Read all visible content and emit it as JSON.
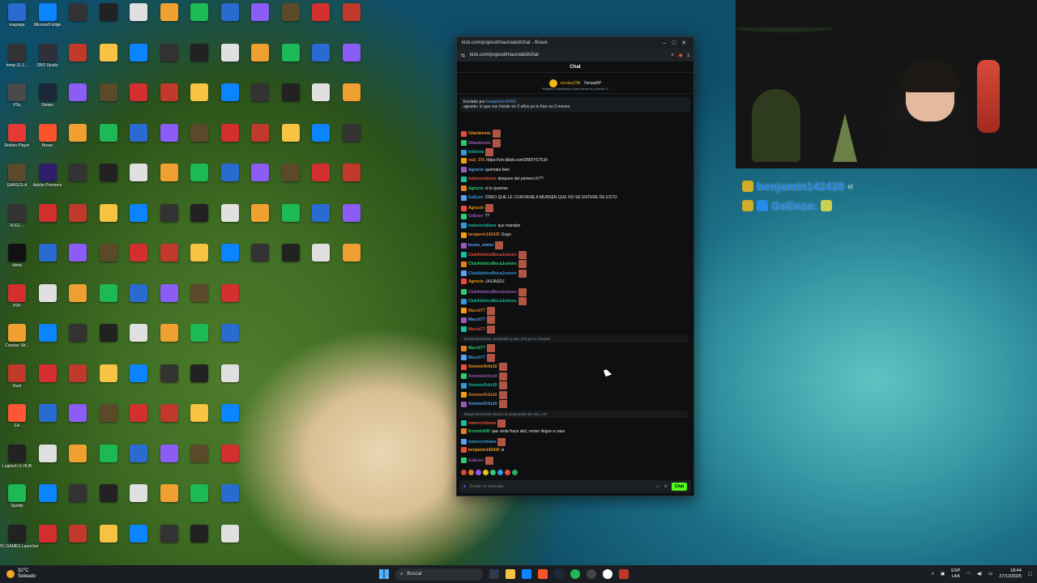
{
  "desktop": {
    "icons": [
      {
        "label": "mapaige",
        "color": "#2a6bd1"
      },
      {
        "label": "temp-11-2...",
        "color": "#333"
      },
      {
        "label": "PSx",
        "color": "#4a4a4a"
      },
      {
        "label": "Roblox Player",
        "color": "#e53935"
      },
      {
        "label": "GARGOLA",
        "color": "#5a4a2a"
      },
      {
        "label": "RJG1...",
        "color": "#333"
      },
      {
        "label": "tiktok",
        "color": "#111"
      },
      {
        "label": "PDF",
        "color": "#d32f2f"
      },
      {
        "label": "Counter-Str...",
        "color": "#f0a030"
      },
      {
        "label": "Rust",
        "color": "#c0392b"
      },
      {
        "label": "EA",
        "color": "#ff5733"
      },
      {
        "label": "Logitech G HUB",
        "color": "#222"
      },
      {
        "label": "Spotify",
        "color": "#1db954"
      },
      {
        "label": "EPIC GAMES Launcher",
        "color": "#222"
      },
      {
        "label": "Microsoft Edge",
        "color": "#0a84ff"
      },
      {
        "label": "OBS Studio",
        "color": "#302f3a"
      },
      {
        "label": "Steam",
        "color": "#1b2838"
      },
      {
        "label": "Brave",
        "color": "#fb542b"
      },
      {
        "label": "Adobe Premiere",
        "color": "#2e1e6b"
      }
    ]
  },
  "browser": {
    "window_title": "kick.com/popout/mauroakd/chat - Brave",
    "url": "kick.com/popout/mauroakd/chat",
    "chat_header": "Chat",
    "pinned": {
      "user1": "nicolas23N",
      "user2": "TampaRP",
      "note": "Regala 1 suscripción para tomar la posición 3"
    },
    "reply": {
      "label": "Enviado por",
      "user": "benjamin142420",
      "text": "agrueto: lo que vos hiciste en 2 años yo lo hice en 3 meses"
    },
    "messages": [
      {
        "user": "Gliankismiz",
        "text": ""
      },
      {
        "user": "Gliankismiz",
        "text": ""
      },
      {
        "user": "milivirta",
        "text": ""
      },
      {
        "user": "raul_27k",
        "text": "https://vm.tiktok.com/ZMDYST5Jr/"
      },
      {
        "user": "Agrucio",
        "text": "quemato bien"
      },
      {
        "user": "matrecristiano",
        "text": "despues del primero fc??"
      },
      {
        "user": "Agrucio",
        "text": "si lo quemas"
      },
      {
        "user": "GsEnzo",
        "text": "CREO QUE LE CONVIENE A MUNSEN QUE NO SE ENTERE DE ESTO"
      },
      {
        "user": "Agrucio",
        "text": ""
      },
      {
        "user": "GsEnzo",
        "text": "??"
      },
      {
        "user": "matrecristiano",
        "text": "que mandan"
      },
      {
        "user": "benjamin142420",
        "text": "Gogo"
      },
      {
        "user": "bruno_emmx",
        "text": ""
      },
      {
        "user": "ClubAtleticoBocaJuniors",
        "text": ""
      },
      {
        "user": "ClubAtleticoBocaJuniors",
        "text": ""
      },
      {
        "user": "ClubAtleticoBocaJuniors",
        "text": ""
      },
      {
        "user": "Agrucio",
        "text": "JAJJASDJ"
      },
      {
        "user": "ClubAtleticoBocaJuniors",
        "text": ""
      },
      {
        "user": "ClubAtleticoBocaJuniors",
        "text": ""
      },
      {
        "user": "Maccii77",
        "text": ""
      },
      {
        "user": "Maccii77",
        "text": ""
      },
      {
        "user": "Maccii77",
        "text": ""
      }
    ],
    "sys1": "benjamin142420 suspendió a raul_27k por 5 minutos",
    "messages2": [
      {
        "user": "Maccii77",
        "text": ""
      },
      {
        "user": "Maccii77",
        "text": ""
      },
      {
        "user": "XeneizeOrtiz10",
        "text": ""
      },
      {
        "user": "XeneizeOrtiz10",
        "text": ""
      },
      {
        "user": "XeneizeOrtiz10",
        "text": ""
      },
      {
        "user": "XeneizeOrtiz10",
        "text": ""
      },
      {
        "user": "XeneizeOrtiz10",
        "text": ""
      }
    ],
    "sys2": "benjamin142420 eliminó la suspensión de raul_27k",
    "messages3": [
      {
        "user": "matrecristiano",
        "text": ""
      },
      {
        "user": "Ernesto030",
        "text": "que onda fraca akd, recien llegue a casa"
      },
      {
        "user": "matrecristiano",
        "text": ""
      },
      {
        "user": "benjamin142420",
        "text": "si"
      },
      {
        "user": "GsEnzo",
        "text": ""
      }
    ],
    "input_placeholder": "Enviar un mensaje",
    "send_label": "Chat"
  },
  "overlay": {
    "line1": "benjamin142420",
    "line1_suffix": "si",
    "line2": "GsEnzo:"
  },
  "taskbar": {
    "weather_temp": "32°C",
    "weather_desc": "Soleado",
    "search_label": "Buscar",
    "lang1": "ESP",
    "lang2": "LAA",
    "time": "18:44",
    "date": "27/12/2025"
  },
  "colors": {
    "kick_green": "#53fc18",
    "chat_bg": "#0d0f11"
  }
}
